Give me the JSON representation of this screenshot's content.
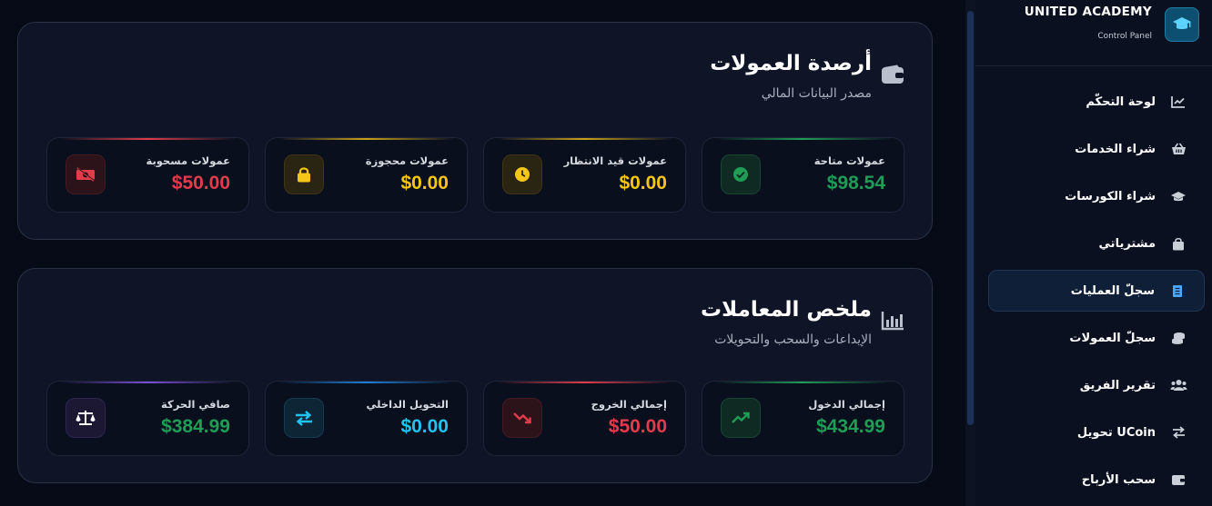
{
  "brand": {
    "title": "UNITED ACADEMY",
    "subtitle": "Control Panel",
    "logo_icon": "graduation-cap-icon"
  },
  "sidebar": {
    "items": [
      {
        "label": "لوحة التحكّم",
        "icon": "chart-line-icon",
        "active": false
      },
      {
        "label": "شراء الخدمات",
        "icon": "basket-icon",
        "active": false
      },
      {
        "label": "شراء الكورسات",
        "icon": "graduation-cap-icon",
        "active": false
      },
      {
        "label": "مشترياتي",
        "icon": "shopping-bag-icon",
        "active": false
      },
      {
        "label": "سجلّ العمليات",
        "icon": "receipt-icon",
        "active": true
      },
      {
        "label": "سجلّ العمولات",
        "icon": "coins-icon",
        "active": false
      },
      {
        "label": "تقرير الفريق",
        "icon": "users-icon",
        "active": false
      },
      {
        "label": "تحويل UCoin",
        "icon": "exchange-icon",
        "active": false
      },
      {
        "label": "سحب الأرباح",
        "icon": "wallet-icon",
        "active": false
      }
    ]
  },
  "commissions": {
    "title": "أرصدة العمولات",
    "subtitle": "مصدر البيانات المالي",
    "icon": "wallet-icon",
    "cards": [
      {
        "label": "عمولات متاحة",
        "value": "$98.54",
        "icon": "check-circle-icon",
        "color": "#1f9d55"
      },
      {
        "label": "عمولات قيد الانتظار",
        "value": "$0.00",
        "icon": "clock-icon",
        "color": "#f5c518"
      },
      {
        "label": "عمولات محجوزة",
        "value": "$0.00",
        "icon": "lock-icon",
        "color": "#f5c518"
      },
      {
        "label": "عمولات مسحوبة",
        "value": "$50.00",
        "icon": "money-bill-icon",
        "color": "#e23c4a"
      }
    ]
  },
  "transactions": {
    "title": "ملخص المعاملات",
    "subtitle": "الإيداعات والسحب والتحويلات",
    "icon": "bar-chart-icon",
    "cards": [
      {
        "label": "إجمالي الدخول",
        "value": "$434.99",
        "icon": "trend-up-icon",
        "color": "#1f9d55"
      },
      {
        "label": "إجمالي الخروج",
        "value": "$50.00",
        "icon": "trend-down-icon",
        "color": "#e23c4a"
      },
      {
        "label": "التحويل الداخلي",
        "value": "$0.00",
        "icon": "exchange-icon",
        "color": "#22c3ee"
      },
      {
        "label": "صافي الحركة",
        "value": "$384.99",
        "icon": "scale-icon",
        "color": "#1f9d55"
      }
    ]
  }
}
